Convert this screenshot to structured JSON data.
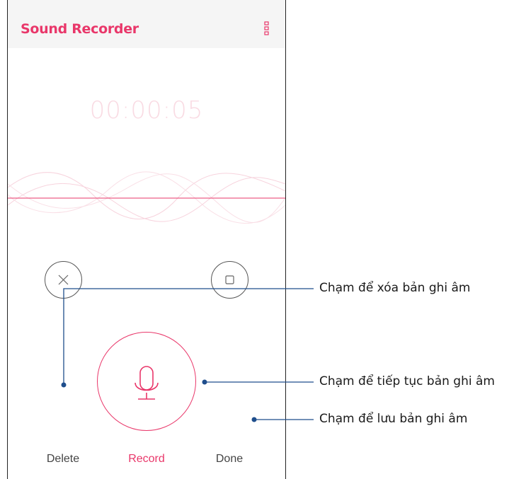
{
  "app": {
    "title": "Sound Recorder",
    "accent_color": "#e9376a",
    "menu_icon": "more-vert-icon"
  },
  "recorder": {
    "elapsed_time": "00:00:05",
    "waveform_icon": "waveform"
  },
  "controls": {
    "delete_label": "Delete",
    "record_label": "Record",
    "done_label": "Done",
    "delete_icon": "close-icon",
    "record_icon": "microphone-icon",
    "done_icon": "stop-square-icon"
  },
  "callouts": {
    "delete": "Chạm để xóa bản ghi âm",
    "resume": "Chạm để tiếp tục bản ghi âm",
    "save": "Chạm để lưu bản ghi âm",
    "line_color": "#1f4e8c"
  }
}
